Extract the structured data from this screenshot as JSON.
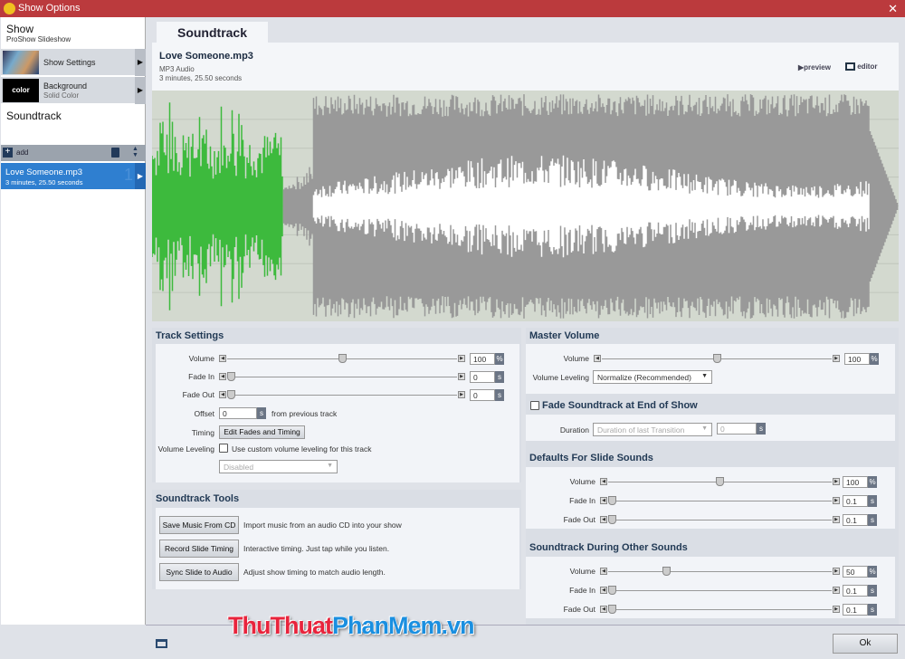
{
  "window": {
    "title": "Show Options",
    "close": "✕"
  },
  "sidebar": {
    "show_title": "Show",
    "show_sub": "ProShow Slideshow",
    "items": [
      {
        "label": "Show Settings"
      },
      {
        "label": "Background",
        "sub": "Solid Color",
        "thumb_text": "color"
      }
    ],
    "soundtrack_title": "Soundtrack",
    "add_label": "add",
    "tracks": [
      {
        "name": "Love Someone.mp3",
        "duration": "3 minutes, 25.50 seconds",
        "index": "1"
      }
    ]
  },
  "main": {
    "tab": "Soundtrack",
    "file": {
      "name": "Love Someone.mp3",
      "type": "MP3 Audio",
      "duration": "3 minutes, 25.50 seconds"
    },
    "preview_label": "preview",
    "editor_label": "editor",
    "waveform": {
      "played_color": "#3dba3d",
      "wave_color": "#999999",
      "played_fraction": 0.175
    }
  },
  "track_settings": {
    "title": "Track Settings",
    "volume": {
      "label": "Volume",
      "value": "100",
      "unit": "%",
      "level": 0.5
    },
    "fade_in": {
      "label": "Fade In",
      "value": "0",
      "unit": "s",
      "level": 0
    },
    "fade_out": {
      "label": "Fade Out",
      "value": "0",
      "unit": "s",
      "level": 0
    },
    "offset": {
      "label": "Offset",
      "value": "0",
      "unit": "s",
      "suffix": "from previous track"
    },
    "timing": {
      "label": "Timing",
      "button": "Edit Fades and Timing"
    },
    "leveling": {
      "label": "Volume Leveling",
      "checkbox": "Use custom volume leveling for this track",
      "select": "Disabled"
    }
  },
  "tools": {
    "title": "Soundtrack Tools",
    "items": [
      {
        "button": "Save Music From CD",
        "desc": "Import music from an audio CD into your show"
      },
      {
        "button": "Record Slide Timing",
        "desc": "Interactive timing. Just tap while you listen."
      },
      {
        "button": "Sync Slide to Audio",
        "desc": "Adjust show timing to match audio length."
      }
    ]
  },
  "master": {
    "title": "Master Volume",
    "volume": {
      "label": "Volume",
      "value": "100",
      "unit": "%",
      "level": 0.5
    },
    "leveling": {
      "label": "Volume Leveling",
      "select": "Normalize (Recommended)"
    }
  },
  "fade_end": {
    "title": "Fade Soundtrack at End of Show",
    "duration_label": "Duration",
    "select": "Duration of last Transition",
    "value": "0",
    "unit": "s"
  },
  "defaults": {
    "title": "Defaults For Slide Sounds",
    "volume": {
      "label": "Volume",
      "value": "100",
      "unit": "%",
      "level": 0.5
    },
    "fade_in": {
      "label": "Fade In",
      "value": "0.1",
      "unit": "s",
      "level": 0
    },
    "fade_out": {
      "label": "Fade Out",
      "value": "0.1",
      "unit": "s",
      "level": 0
    }
  },
  "other": {
    "title": "Soundtrack During Other Sounds",
    "volume": {
      "label": "Volume",
      "value": "50",
      "unit": "%",
      "level": 0.25
    },
    "fade_in": {
      "label": "Fade In",
      "value": "0.1",
      "unit": "s",
      "level": 0
    },
    "fade_out": {
      "label": "Fade Out",
      "value": "0.1",
      "unit": "s",
      "level": 0
    }
  },
  "footer": {
    "ok": "Ok"
  },
  "watermark": "ThuThuatPhanMem.vn"
}
